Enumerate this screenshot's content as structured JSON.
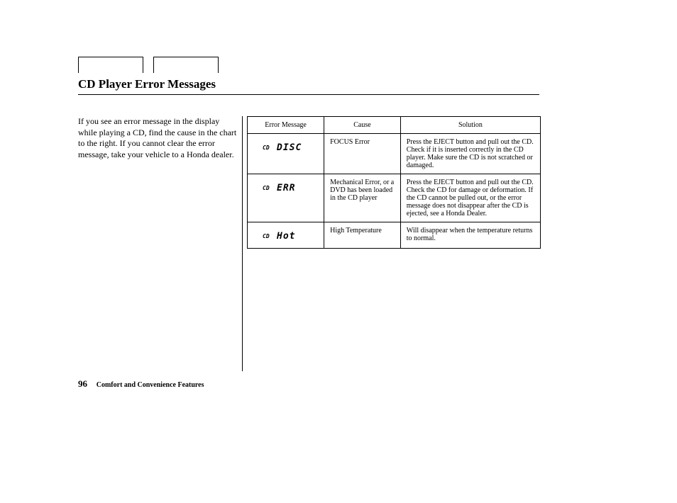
{
  "title": "CD Player Error Messages",
  "intro": "If you see an error message in the display while playing a CD, find the cause in the chart to the right. If you cannot clear the error message, take your vehicle to a Honda dealer.",
  "table": {
    "headers": {
      "error": "Error Message",
      "cause": "Cause",
      "solution": "Solution"
    },
    "rows": [
      {
        "error_display_name": "cd-disc-error-icon",
        "cause": "FOCUS Error",
        "solution": "Press the EJECT button and pull out the CD. Check if it is inserted correctly in the CD player. Make sure the CD is not scratched or damaged."
      },
      {
        "error_display_name": "cd-err-error-icon",
        "cause": "Mechanical Error, or a DVD has been loaded in the CD player",
        "solution": "Press the EJECT button and pull out the CD. Check the CD for damage or deformation. If the CD cannot be pulled out, or the error message does not disappear after the CD is ejected, see a Honda Dealer."
      },
      {
        "error_display_name": "cd-hot-error-icon",
        "cause": "High Temperature",
        "solution": "Will disappear when the temperature returns to normal."
      }
    ]
  },
  "footer": {
    "page": "96",
    "section": "Comfort and Convenience Features"
  }
}
